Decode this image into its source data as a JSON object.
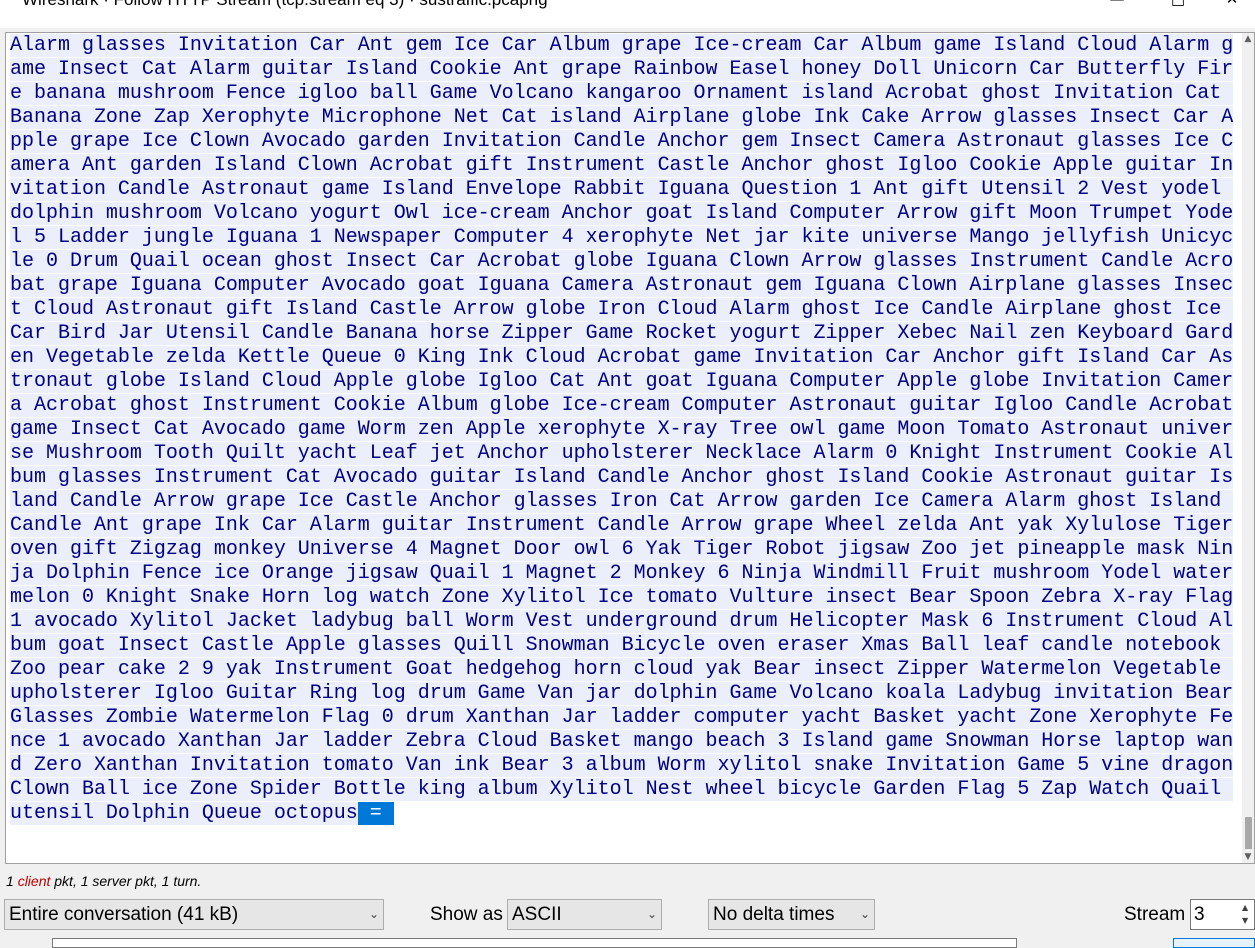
{
  "window": {
    "title": "Wireshark · Follow HTTP Stream (tcp.stream eq 3) · sustraffic.pcapng",
    "minimize": "—",
    "maximize": "□",
    "close": "✕"
  },
  "stream": {
    "lines": [
      "Alarm glasses Invitation Car Ant gem Ice Car Album grape Ice-cream Car Album game Island Cloud Alarm g",
      "ame Insect Cat Alarm guitar Island Cookie Ant grape Rainbow Easel honey Doll Unicorn Car Butterfly Fir",
      "e banana mushroom Fence igloo ball Game Volcano kangaroo Ornament island Acrobat ghost Invitation Cat ",
      "Banana Zone Zap Xerophyte Microphone Net Cat island Airplane globe Ink Cake Arrow glasses Insect Car A",
      "pple grape Ice Clown Avocado garden Invitation Candle Anchor gem Insect Camera Astronaut glasses Ice C",
      "amera Ant garden Island Clown Acrobat gift Instrument Castle Anchor ghost Igloo Cookie Apple guitar In",
      "vitation Candle Astronaut game Island Envelope Rabbit Iguana Question 1 Ant gift Utensil 2 Vest yodel ",
      "dolphin mushroom Volcano yogurt Owl ice-cream Anchor goat Island Computer Arrow gift Moon Trumpet Yode",
      "l 5 Ladder jungle Iguana 1 Newspaper Computer 4 xerophyte Net jar kite universe Mango jellyfish Unicyc",
      "le 0 Drum Quail ocean ghost Insect Car Acrobat globe Iguana Clown Arrow glasses Instrument Candle Acro",
      "bat grape Iguana Computer Avocado goat Iguana Camera Astronaut gem Iguana Clown Airplane glasses Insec",
      "t Cloud Astronaut gift Island Castle Arrow globe Iron Cloud Alarm ghost Ice Candle Airplane ghost Ice ",
      "Car Bird Jar Utensil Candle Banana horse Zipper Game Rocket yogurt Zipper Xebec Nail zen Keyboard Gard",
      "en Vegetable zelda Kettle Queue 0 King Ink Cloud Acrobat game Invitation Car Anchor gift Island Car As",
      "tronaut globe Island Cloud Apple globe Igloo Cat Ant goat Iguana Computer Apple globe Invitation Camer",
      "a Acrobat ghost Instrument Cookie Album globe Ice-cream Computer Astronaut guitar Igloo Candle Acrobat",
      "game Insect Cat Avocado game Worm zen Apple xerophyte X-ray Tree owl game Moon Tomato Astronaut univer",
      "se Mushroom Tooth Quilt yacht Leaf jet Anchor upholsterer Necklace Alarm 0 Knight Instrument Cookie Al",
      "bum glasses Instrument Cat Avocado guitar Island Candle Anchor ghost Island Cookie Astronaut guitar Is",
      "land Candle Arrow grape Ice Castle Anchor glasses Iron Cat Arrow garden Ice Camera Alarm ghost Island ",
      "Candle Ant grape Ink Car Alarm guitar Instrument Candle Arrow grape Wheel zelda Ant yak Xylulose Tiger",
      "oven gift Zigzag monkey Universe 4 Magnet Door owl 6 Yak Tiger Robot jigsaw Zoo jet pineapple mask Nin",
      "ja Dolphin Fence ice Orange jigsaw Quail 1 Magnet 2 Monkey 6 Ninja Windmill Fruit mushroom Yodel water",
      "melon 0 Knight Snake Horn log watch Zone Xylitol Ice tomato Vulture insect Bear Spoon Zebra X-ray Flag",
      "1 avocado Xylitol Jacket ladybug ball Worm Vest underground drum Helicopter Mask 6 Instrument Cloud Al",
      "bum goat Insect Castle Apple glasses Quill Snowman Bicycle oven eraser Xmas Ball leaf candle notebook ",
      "Zoo pear cake 2 9 yak Instrument Goat hedgehog horn cloud yak Bear insect Zipper Watermelon Vegetable ",
      "upholsterer Igloo Guitar Ring log drum Game Van jar dolphin Game Volcano koala Ladybug invitation Bear",
      "Glasses Zombie Watermelon Flag 0 drum Xanthan Jar ladder computer yacht Basket yacht Zone Xerophyte Fe",
      "nce 1 avocado Xanthan Jar ladder Zebra Cloud Basket mango beach 3 Island game Snowman Horse laptop wan",
      "d Zero Xanthan Invitation tomato Van ink Bear 3 album Worm xylitol snake Invitation Game 5 vine dragon",
      "Clown Ball ice Zone Spider Bottle king album Xylitol Nest wheel bicycle Garden Flag 5 Zap Watch Quail ",
      "utensil Dolphin Queue octopus"
    ],
    "selected_tail": " = "
  },
  "status": {
    "prefix": "1 ",
    "client_word": "client",
    "suffix": " pkt, 1 server pkt, 1 turn."
  },
  "controls": {
    "conversation": "Entire conversation (41 kB)",
    "show_as_label": "Show as",
    "show_as_value": "ASCII",
    "delta_times": "No delta times",
    "stream_label": "Stream",
    "stream_value": "3"
  },
  "icons": {
    "dropdown": "chevron-down-icon",
    "spin_up": "spin-up-icon",
    "spin_down": "spin-down-icon"
  },
  "colors": {
    "client_text": "#000080",
    "client_highlight": "#ebeefb",
    "selection": "#0078d7",
    "client_label": "#c00000"
  }
}
